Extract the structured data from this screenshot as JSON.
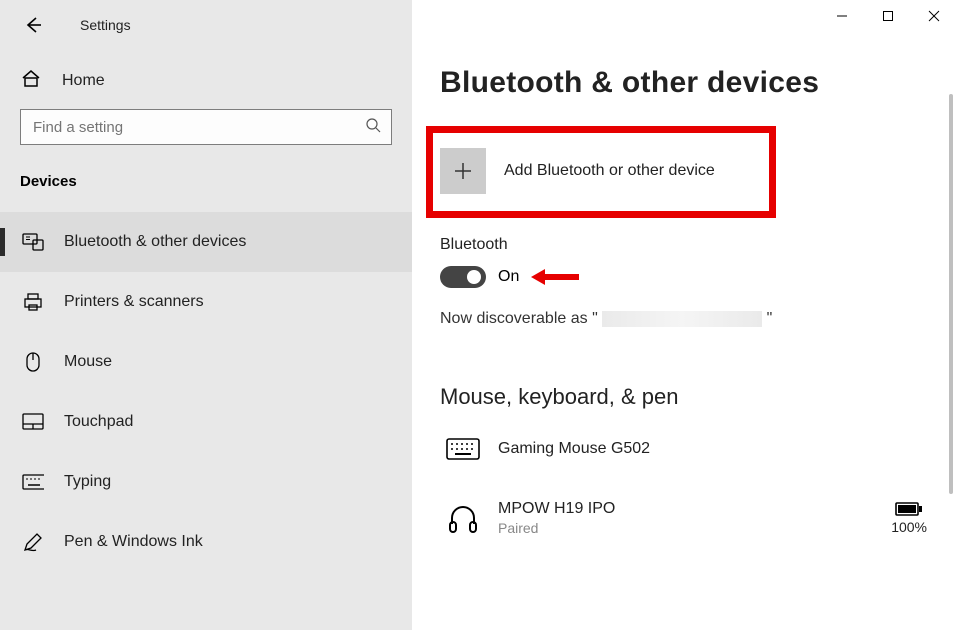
{
  "window": {
    "title": "Settings"
  },
  "search": {
    "placeholder": "Find a setting"
  },
  "home_label": "Home",
  "category": "Devices",
  "nav_items": [
    {
      "label": "Bluetooth & other devices"
    },
    {
      "label": "Printers & scanners"
    },
    {
      "label": "Mouse"
    },
    {
      "label": "Touchpad"
    },
    {
      "label": "Typing"
    },
    {
      "label": "Pen & Windows Ink"
    }
  ],
  "page": {
    "title": "Bluetooth & other devices",
    "add_label": "Add Bluetooth or other device",
    "bluetooth_heading": "Bluetooth",
    "toggle_state": "On",
    "discoverable_prefix": "Now discoverable as \"",
    "discoverable_suffix": "\"",
    "section_mouse": "Mouse, keyboard, & pen",
    "devices": [
      {
        "name": "Gaming Mouse G502",
        "status": ""
      },
      {
        "name": "MPOW H19 IPO",
        "status": "Paired",
        "battery": "100%"
      }
    ]
  }
}
